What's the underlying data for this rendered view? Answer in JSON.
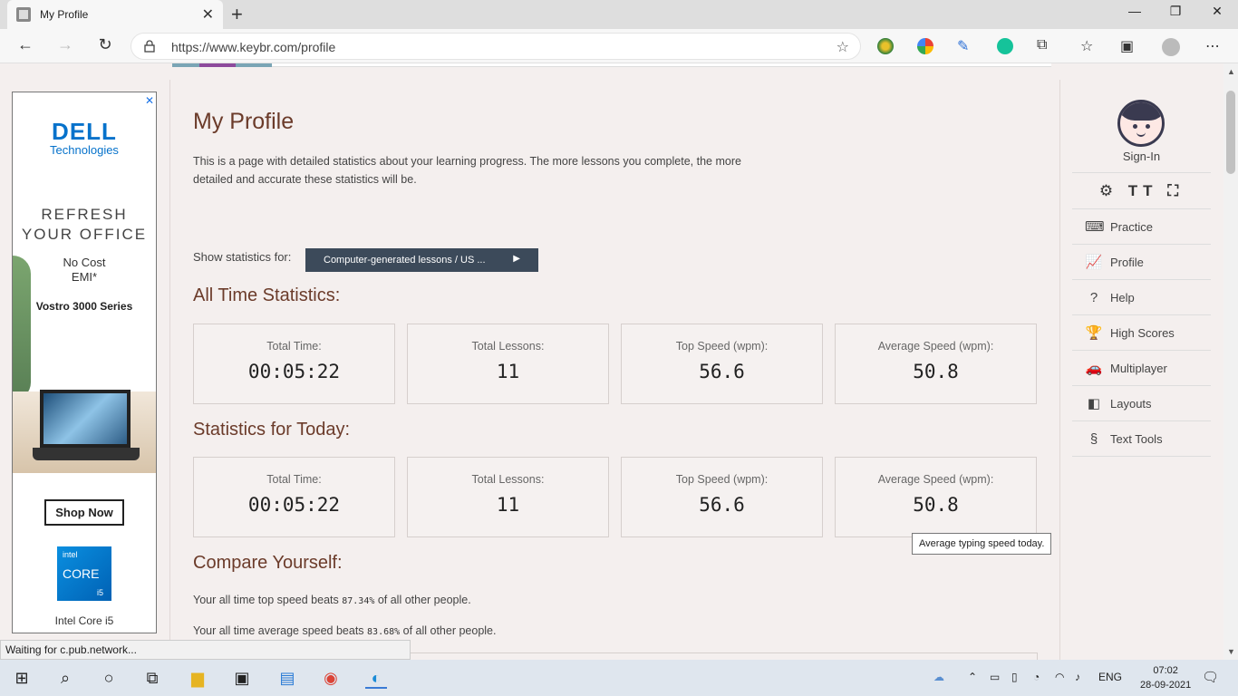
{
  "browser": {
    "tab_title": "My Profile",
    "tab_close": "✕",
    "new_tab": "+",
    "url": "https://www.keybr.com/profile",
    "win_min": "—",
    "win_restore": "❐",
    "win_close": "✕"
  },
  "ad": {
    "close": "✕",
    "brand": "DELL",
    "brand_sub": "Technologies",
    "headline_1": "REFRESH",
    "headline_2": "YOUR OFFICE",
    "offer_1": "No Cost",
    "offer_2": "EMI*",
    "model": "Vostro 3000 Series",
    "cta": "Shop Now",
    "intel_1": "intel",
    "intel_2": "CORE",
    "intel_3": "i5",
    "intel_caption": "Intel Core i5"
  },
  "main": {
    "title": "My Profile",
    "intro": "This is a page with detailed statistics about your learning progress. The more lessons you complete, the more detailed and accurate these statistics will be.",
    "show_label": "Show statistics for:",
    "select_value": "Computer-generated lessons / US ...",
    "select_arrow": "▶",
    "all_time_heading": "All Time Statistics:",
    "today_heading": "Statistics for Today:",
    "compare_heading": "Compare Yourself:",
    "all_time": {
      "total_time_label": "Total Time:",
      "total_time": "00:05:22",
      "total_lessons_label": "Total Lessons:",
      "total_lessons": "11",
      "top_speed_label": "Top Speed (wpm):",
      "top_speed": "56.6",
      "avg_speed_label": "Average Speed (wpm):",
      "avg_speed": "50.8"
    },
    "today": {
      "total_time_label": "Total Time:",
      "total_time": "00:05:22",
      "total_lessons_label": "Total Lessons:",
      "total_lessons": "11",
      "top_speed_label": "Top Speed (wpm):",
      "top_speed": "56.6",
      "avg_speed_label": "Average Speed (wpm):",
      "avg_speed": "50.8"
    },
    "compare_top_pre": "Your all time top speed beats ",
    "compare_top_pct": "87.34%",
    "compare_top_post": " of all other people.",
    "compare_avg_pre": "Your all time average speed beats ",
    "compare_avg_pct": "83.68%",
    "compare_avg_post": " of all other people.",
    "tooltip": "Average typing speed today."
  },
  "sidebar": {
    "sign_in": "Sign-In",
    "tools": "⚙ TT ⛶",
    "items": [
      {
        "icon": "⌨",
        "label": "Practice"
      },
      {
        "icon": "📈",
        "label": "Profile"
      },
      {
        "icon": "?",
        "label": "Help"
      },
      {
        "icon": "🏆",
        "label": "High Scores"
      },
      {
        "icon": "🚗",
        "label": "Multiplayer"
      },
      {
        "icon": "◧",
        "label": "Layouts"
      },
      {
        "icon": "§",
        "label": "Text Tools"
      }
    ]
  },
  "status_text": "Waiting for c.pub.network...",
  "taskbar": {
    "lang": "ENG",
    "time": "07:02",
    "date": "28-09-2021"
  }
}
